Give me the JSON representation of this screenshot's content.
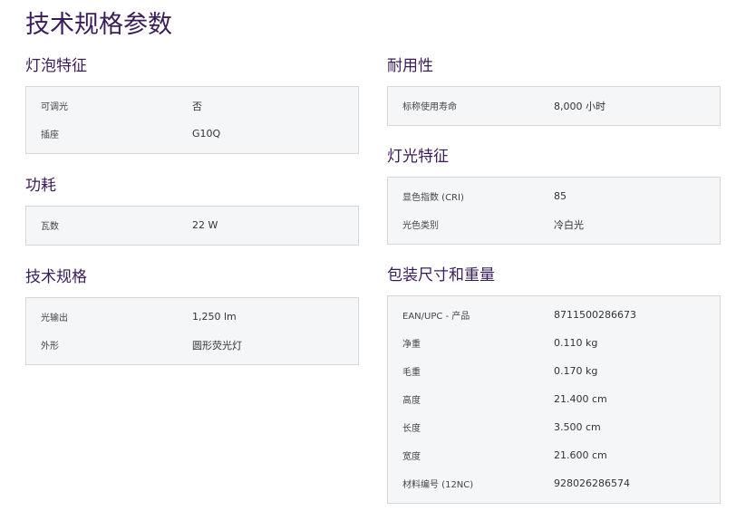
{
  "page_title": "技术规格参数",
  "left_column": [
    {
      "title": "灯泡特征",
      "rows": [
        {
          "label": "可调光",
          "value": "否"
        },
        {
          "label": "插座",
          "value": "G10Q"
        }
      ]
    },
    {
      "title": "功耗",
      "rows": [
        {
          "label": "瓦数",
          "value": "22 W"
        }
      ]
    },
    {
      "title": "技术规格",
      "rows": [
        {
          "label": "光输出",
          "value": "1,250 lm"
        },
        {
          "label": "外形",
          "value": "圆形荧光灯"
        }
      ]
    }
  ],
  "right_column": [
    {
      "title": "耐用性",
      "rows": [
        {
          "label": "标称使用寿命",
          "value": "8,000 小时"
        }
      ]
    },
    {
      "title": "灯光特征",
      "rows": [
        {
          "label": "显色指数 (CRI)",
          "value": "85"
        },
        {
          "label": "光色类别",
          "value": "冷白光"
        }
      ]
    },
    {
      "title": "包装尺寸和重量",
      "rows": [
        {
          "label": "EAN/UPC - 产品",
          "value": "8711500286673"
        },
        {
          "label": "净重",
          "value": "0.110 kg"
        },
        {
          "label": "毛重",
          "value": "0.170 kg"
        },
        {
          "label": "高度",
          "value": "21.400 cm"
        },
        {
          "label": "长度",
          "value": "3.500 cm"
        },
        {
          "label": "宽度",
          "value": "21.600 cm"
        },
        {
          "label": "材料编号 (12NC)",
          "value": "928026286574"
        }
      ]
    }
  ]
}
